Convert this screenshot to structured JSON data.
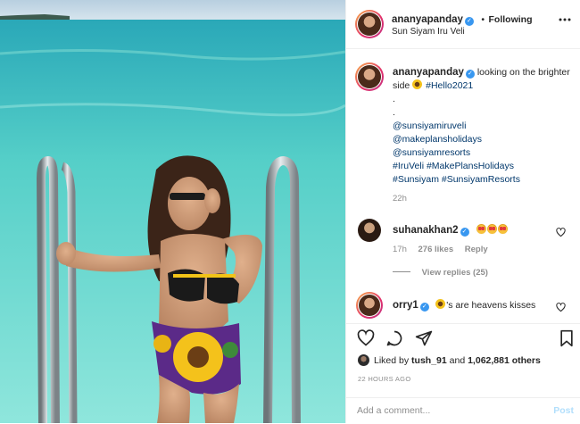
{
  "header": {
    "username": "ananyapanday",
    "separator": "•",
    "follow_status": "Following",
    "location": "Sun Siyam Iru Veli",
    "more_icon": "more-horizontal-icon"
  },
  "caption": {
    "username": "ananyapanday",
    "text": "looking on the brighter side",
    "hashtag_line1": "#Hello2021",
    "dot1": ".",
    "dot2": ".",
    "mentions": [
      "@sunsiyamiruveli",
      "@makeplansholidays",
      "@sunsiyamresorts"
    ],
    "hashtags_line_a": "#IruVeli #MakePlansHolidays",
    "hashtags_line_b": "#Sunsiyam #SunsiyamResorts",
    "time": "22h"
  },
  "comments": [
    {
      "username": "suhanakhan2",
      "time": "17h",
      "likes": "276 likes",
      "reply": "Reply",
      "view_replies": "View replies (25)"
    },
    {
      "username": "orry1",
      "text": "'s are heavens kisses"
    }
  ],
  "actions": {
    "like_icon": "heart-outline-icon",
    "comment_icon": "comment-icon",
    "share_icon": "send-icon",
    "save_icon": "bookmark-icon",
    "liked_by_prefix": "Liked by",
    "liked_by_user": "tush_91",
    "liked_by_and": "and",
    "liked_by_others": "1,062,881 others",
    "timestamp": "22 HOURS AGO"
  },
  "add_comment": {
    "placeholder": "Add a comment...",
    "post_label": "Post"
  },
  "colors": {
    "verified": "#3897f0",
    "link": "#00376b",
    "muted": "#8e8e8e",
    "post_disabled": "#b2dffc",
    "sea": "#7fd9d2"
  }
}
